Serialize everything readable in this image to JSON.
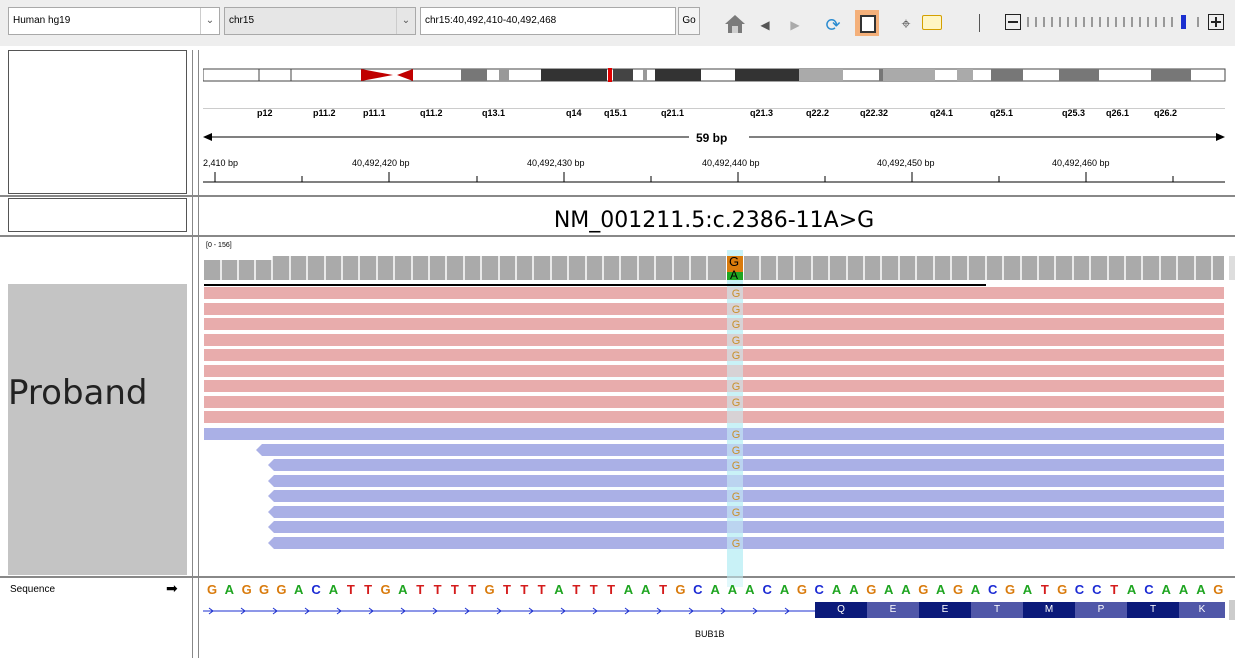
{
  "toolbar": {
    "genome": "Human hg19",
    "chromosome": "chr15",
    "locus": "chr15:40,492,410-40,492,468",
    "go_label": "Go"
  },
  "ideogram": {
    "bands": [
      "p12",
      "p11.2",
      "p11.1",
      "q11.2",
      "q13.1",
      "q14",
      "q15.1",
      "q21.1",
      "q21.3",
      "q22.2",
      "q22.32",
      "q24.1",
      "q25.1",
      "q25.3",
      "q26.1",
      "q26.2"
    ]
  },
  "ruler": {
    "span": "59 bp",
    "ticks": [
      "2,410 bp",
      "40,492,420 bp",
      "40,492,430 bp",
      "40,492,440 bp",
      "40,492,450 bp",
      "40,492,460 bp"
    ]
  },
  "variant": {
    "label": "NM_001211.5:c.2386-11A>G"
  },
  "alignment": {
    "track_name": "Proband",
    "coverage_range": "[0 - 156]",
    "coverage_alleles": [
      "G",
      "A"
    ],
    "read_allele": "G"
  },
  "sequence": {
    "track_name": "Sequence",
    "bases": "GAGGGACATTGATTTTGTTTATTTAATGCAAACAGCAAGAAGAGACGATGCCTACAAAG",
    "amino_acids": [
      "Q",
      "E",
      "E",
      "T",
      "M",
      "P",
      "T",
      "K"
    ],
    "gene": "BUB1B"
  },
  "colors": {
    "A": "#1fa521",
    "C": "#1c2bd4",
    "G": "#d97b0d",
    "T": "#d41c1c",
    "pink_read": "#e8acac",
    "blue_read": "#aab0e6"
  }
}
